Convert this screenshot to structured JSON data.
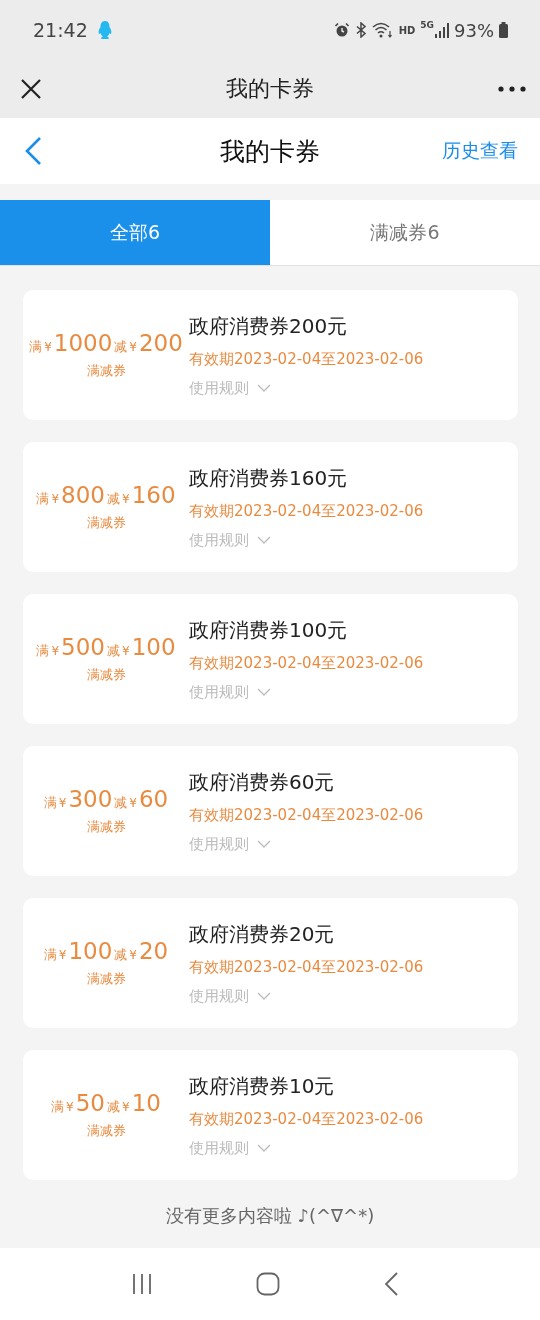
{
  "status_bar": {
    "time": "21:42",
    "network": "5G",
    "hd": "HD",
    "battery": "93%"
  },
  "top_bar": {
    "title": "我的卡券"
  },
  "header": {
    "title": "我的卡券",
    "action": "历史查看"
  },
  "tabs": [
    {
      "label": "全部6",
      "selected": true
    },
    {
      "label": "满减券6",
      "selected": false
    }
  ],
  "coupons": [
    {
      "min_label": "满",
      "currency_1": "¥",
      "threshold": "1000",
      "cut_label": "减",
      "currency_2": "¥",
      "discount": "200",
      "type": "满减券",
      "title": "政府消费券200元",
      "validity": "有效期2023-02-04至2023-02-06",
      "rules": "使用规则"
    },
    {
      "min_label": "满",
      "currency_1": "¥",
      "threshold": "800",
      "cut_label": "减",
      "currency_2": "¥",
      "discount": "160",
      "type": "满减券",
      "title": "政府消费券160元",
      "validity": "有效期2023-02-04至2023-02-06",
      "rules": "使用规则"
    },
    {
      "min_label": "满",
      "currency_1": "¥",
      "threshold": "500",
      "cut_label": "减",
      "currency_2": "¥",
      "discount": "100",
      "type": "满减券",
      "title": "政府消费券100元",
      "validity": "有效期2023-02-04至2023-02-06",
      "rules": "使用规则"
    },
    {
      "min_label": "满",
      "currency_1": "¥",
      "threshold": "300",
      "cut_label": "减",
      "currency_2": "¥",
      "discount": "60",
      "type": "满减券",
      "title": "政府消费券60元",
      "validity": "有效期2023-02-04至2023-02-06",
      "rules": "使用规则"
    },
    {
      "min_label": "满",
      "currency_1": "¥",
      "threshold": "100",
      "cut_label": "减",
      "currency_2": "¥",
      "discount": "20",
      "type": "满减券",
      "title": "政府消费券20元",
      "validity": "有效期2023-02-04至2023-02-06",
      "rules": "使用规则"
    },
    {
      "min_label": "满",
      "currency_1": "¥",
      "threshold": "50",
      "cut_label": "减",
      "currency_2": "¥",
      "discount": "10",
      "type": "满减券",
      "title": "政府消费券10元",
      "validity": "有效期2023-02-04至2023-02-06",
      "rules": "使用规则"
    }
  ],
  "footer": "没有更多内容啦 ♪(^∇^*)"
}
